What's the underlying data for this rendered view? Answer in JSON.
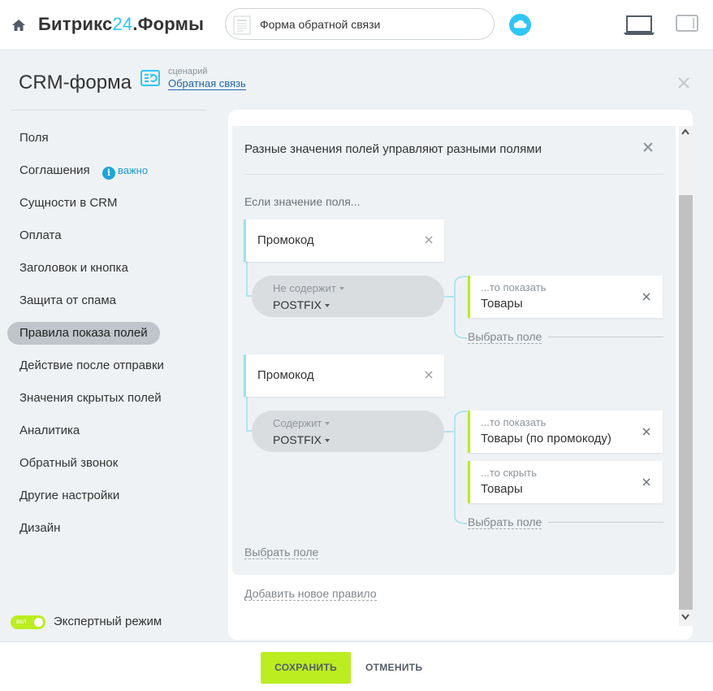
{
  "header": {
    "brand_main": "Битрикс",
    "brand_num": "24",
    "brand_suffix": ".Формы",
    "form_select_value": "Форма обратной связи"
  },
  "page": {
    "title": "CRM-форма",
    "scenario_caption": "сценарий",
    "scenario_link": "Обратная связь"
  },
  "sidebar": {
    "items": [
      {
        "label": "Поля"
      },
      {
        "label": "Соглашения"
      },
      {
        "label": "Сущности в CRM"
      },
      {
        "label": "Оплата"
      },
      {
        "label": "Заголовок и кнопка"
      },
      {
        "label": "Защита от спама"
      },
      {
        "label": "Правила показа полей",
        "active": true
      },
      {
        "label": "Действие после отправки"
      },
      {
        "label": "Значения скрытых полей"
      },
      {
        "label": "Аналитика"
      },
      {
        "label": "Обратный звонок"
      },
      {
        "label": "Другие настройки"
      },
      {
        "label": "Дизайн"
      }
    ],
    "important_badge": "важно",
    "important_icon_glyph": "i",
    "expert_toggle_label": "вкл",
    "expert_mode_label": "Экспертный режим"
  },
  "rules": {
    "title": "Разные значения полей управляют разными полями",
    "if_label": "Если значение поля...",
    "groups": [
      {
        "field": "Промокод",
        "operator": "Не содержит",
        "value": "POSTFIX",
        "actions": [
          {
            "action": "...то показать",
            "target": "Товары"
          }
        ],
        "pick_field": "Выбрать поле"
      },
      {
        "field": "Промокод",
        "operator": "Содержит",
        "value": "POSTFIX",
        "actions": [
          {
            "action": "...то показать",
            "target": "Товары (по промокоду)"
          },
          {
            "action": "...то скрыть",
            "target": "Товары"
          }
        ],
        "pick_field": "Выбрать поле"
      }
    ],
    "pick_field": "Выбрать поле",
    "add_rule": "Добавить новое правило"
  },
  "footer": {
    "save": "СОХРАНИТЬ",
    "cancel": "ОТМЕНИТЬ"
  },
  "colors": {
    "accent_green": "#bbed21",
    "accent_blue": "#2fc6f6",
    "link_blue": "#2067b0"
  }
}
